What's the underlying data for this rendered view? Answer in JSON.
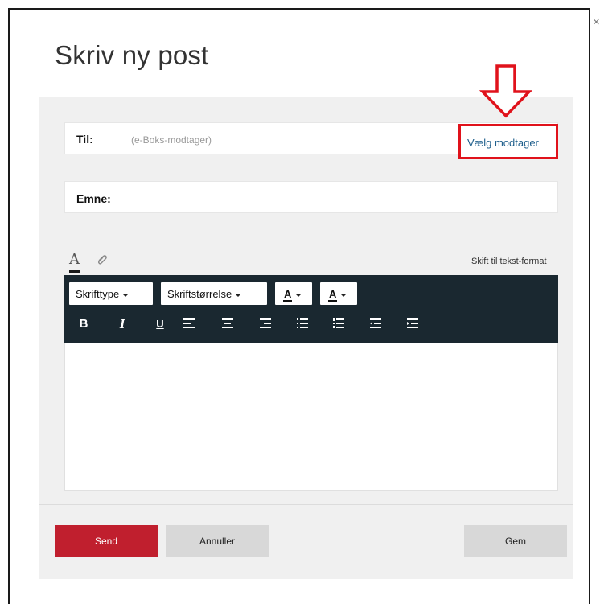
{
  "dialog": {
    "title": "Skriv ny post",
    "close_icon": "close-icon"
  },
  "to_field": {
    "label": "Til:",
    "placeholder": "(e-Boks-modtager)",
    "choose_recipient": "Vælg modtager"
  },
  "subject_field": {
    "label": "Emne:"
  },
  "formatting": {
    "format_icon": "text-format-icon",
    "attach_icon": "paperclip-icon",
    "switch_to_text": "Skift til tekst-format",
    "font_dropdown": "Skrifttype",
    "size_dropdown": "Skriftstørrelse",
    "font_color_label": "A",
    "highlight_color_label": "A",
    "icons": [
      "bold-icon",
      "italic-icon",
      "underline-icon",
      "align-left-icon",
      "align-center-icon",
      "align-right-icon",
      "bullet-list-icon",
      "numbered-list-icon",
      "outdent-icon",
      "indent-icon"
    ],
    "bold_label": "B",
    "italic_label": "I",
    "underline_label": "U"
  },
  "actions": {
    "send": "Send",
    "cancel": "Annuller",
    "save": "Gem"
  },
  "colors": {
    "send_button": "#c01f2e",
    "toolbar": "#1a2830",
    "highlight_box": "#e0121b",
    "link": "#1f5f8c"
  }
}
